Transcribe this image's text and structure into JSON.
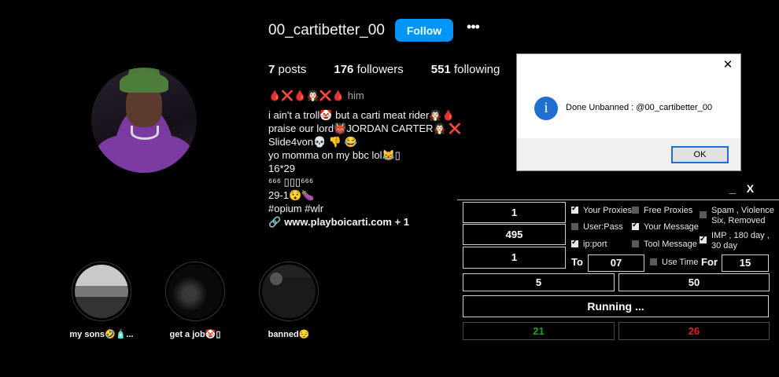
{
  "profile": {
    "username": "00_cartibetter_00",
    "follow_label": "Follow",
    "more_label": "•••",
    "stats": {
      "posts_value": "7",
      "posts_label": "posts",
      "followers_value": "176",
      "followers_label": "followers",
      "following_value": "551",
      "following_label": "following"
    },
    "pronouns": "🩸❌🩸🧛🏻❌🩸 him",
    "bio_lines": [
      "i ain't a troll🤡 but a carti meat rider🧛🏻🩸",
      "praise our lord👹JORDAN CARTER🧛🏻 ❌",
      "Slide4von💀 👎 😂",
      "yo momma on my bbc lol😹▯",
      "16*29",
      "⁶⁶⁶ ▯▯▯⁶⁶⁶",
      "29-1😯🍆",
      "#opium #wlr"
    ],
    "link_icon": "🔗",
    "link_text": "www.playboicarti.com",
    "link_extra": " + 1"
  },
  "highlights": [
    {
      "label": "my sons🤣🧴..."
    },
    {
      "label": "get a job🤡▯"
    },
    {
      "label": "banned😔"
    }
  ],
  "dialog": {
    "close_label": "✕",
    "icon_glyph": "i",
    "message": "Done Unbanned : @00_cartibetter_00",
    "ok_label": "OK"
  },
  "panel": {
    "minimize_label": "_",
    "close_label": "X",
    "counter_1": "1",
    "counter_2": "495",
    "counter_3": "1",
    "to_label": "To",
    "to_value": "07",
    "use_time_label": "Use Time",
    "for_label": "For",
    "for_value": "15",
    "left_value": "5",
    "right_value": "50",
    "status": "Running ...",
    "success_count": "21",
    "fail_count": "26",
    "options": {
      "your_proxies": {
        "label": "Your Proxies",
        "checked": true
      },
      "free_proxies": {
        "label": "Free Proxies",
        "checked": false
      },
      "spam": {
        "label": "Spam , Violence Six, Removed",
        "checked": false
      },
      "user_pass": {
        "label": "User:Pass",
        "checked": false
      },
      "your_message": {
        "label": "Your Message",
        "checked": true
      },
      "imp": {
        "label": "IMP , 180 day , 30 day",
        "checked": true
      },
      "ip_port": {
        "label": "ip:port",
        "checked": true
      },
      "tool_message": {
        "label": "Tool Message",
        "checked": false
      }
    },
    "colors": {
      "success": "#1fa31f",
      "fail": "#e31d1d"
    }
  }
}
